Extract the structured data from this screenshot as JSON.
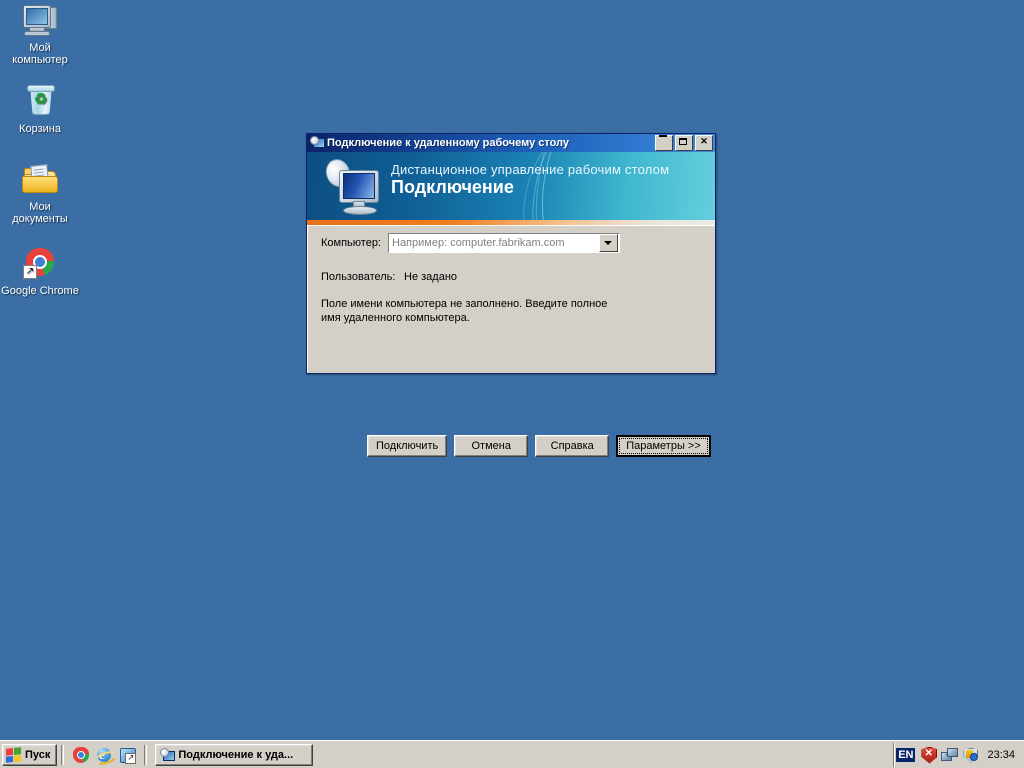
{
  "desktop": {
    "background_color": "#3a6ea5",
    "icons": [
      {
        "name": "my-computer",
        "icon": "computer-icon",
        "label_line1": "Мой",
        "label_line2": "компьютер"
      },
      {
        "name": "recycle-bin",
        "icon": "recycle-bin-icon",
        "label_line1": "Корзина",
        "label_line2": ""
      },
      {
        "name": "my-documents",
        "icon": "folder-documents-icon",
        "label_line1": "Мои",
        "label_line2": "документы"
      },
      {
        "name": "google-chrome",
        "icon": "chrome-icon",
        "label_line1": "Google Chrome",
        "label_line2": ""
      }
    ]
  },
  "dialog": {
    "title": "Подключение к удаленному рабочему столу",
    "title_icon": "remote-desktop-icon",
    "window_buttons": {
      "minimize": "_",
      "maximize": "□",
      "close": "✕"
    },
    "banner": {
      "subtitle": "Дистанционное управление рабочим столом",
      "title": "Подключение",
      "logo_icon": "monitor-satellite-icon",
      "gradient_from": "#0d4f82",
      "gradient_to": "#64cfdd",
      "accent_bar_color": "#ef7d1d"
    },
    "fields": {
      "computer_label": "Компьютер:",
      "computer_placeholder": "Например: computer.fabrikam.com",
      "computer_value": "",
      "user_label": "Пользователь:",
      "user_value": "Не задано"
    },
    "hint_line1": "Поле имени компьютера не заполнено. Введите полное",
    "hint_line2": "имя удаленного компьютера.",
    "buttons": [
      {
        "name": "connect-button",
        "label": "Подключить",
        "default": false
      },
      {
        "name": "cancel-button",
        "label": "Отмена",
        "default": false
      },
      {
        "name": "help-button",
        "label": "Справка",
        "default": false
      },
      {
        "name": "options-button",
        "label": "Параметры >>",
        "default": true
      }
    ]
  },
  "taskbar": {
    "start_label": "Пуск",
    "start_icon": "windows-flag-icon",
    "quick_launch": [
      {
        "name": "quick-launch-chrome",
        "icon": "chrome-icon"
      },
      {
        "name": "quick-launch-internet-explorer",
        "icon": "internet-explorer-icon"
      },
      {
        "name": "quick-launch-show-desktop",
        "icon": "show-desktop-icon"
      }
    ],
    "task_buttons": [
      {
        "name": "taskbar-item-rdp",
        "icon": "remote-desktop-icon",
        "label": "Подключение к уда..."
      }
    ],
    "tray": {
      "language": "EN",
      "icons": [
        {
          "name": "security-alert-icon",
          "icon": "red-shield-icon"
        },
        {
          "name": "network-connections-icon",
          "icon": "network-icon"
        },
        {
          "name": "security-center-icon",
          "icon": "shield-key-icon"
        }
      ],
      "clock": "23:34"
    }
  }
}
